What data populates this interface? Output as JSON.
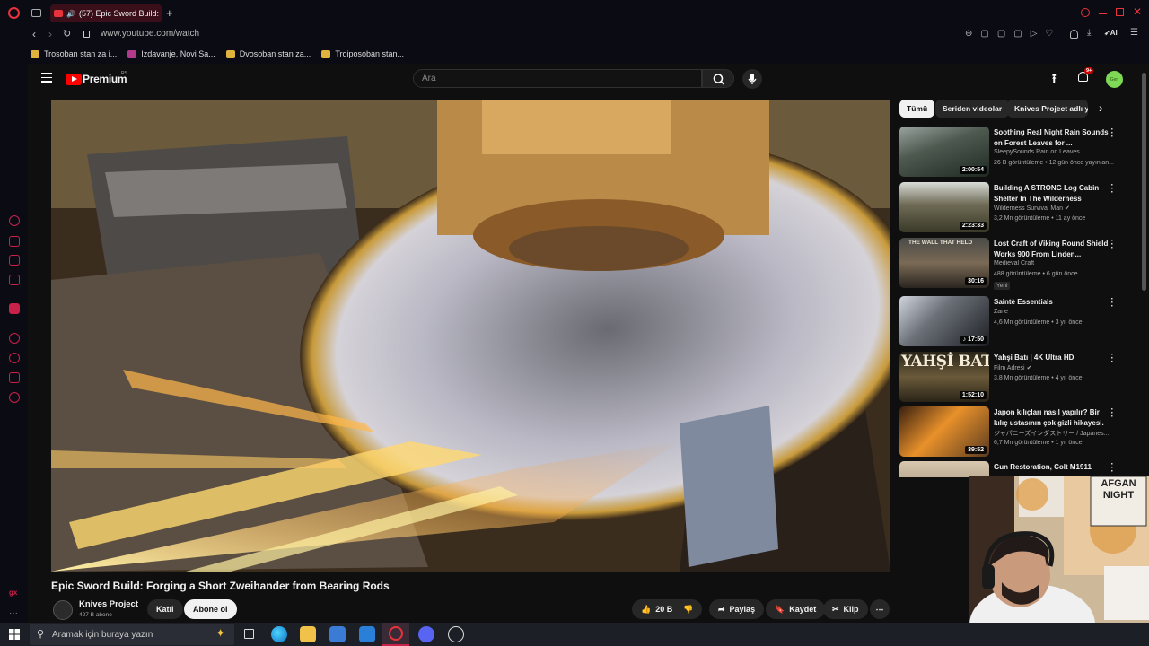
{
  "browser": {
    "tab_title": "(57) Epic Sword Build:",
    "url": "www.youtube.com/watch",
    "bookmarks": [
      "Trosoban stan za i...",
      "Izdavanje, Novi Sa...",
      "Dvosoban stan za...",
      "Troiposoban stan..."
    ],
    "ai_label": "AI",
    "side_label": "gx"
  },
  "youtube": {
    "logo_text": "Premium",
    "logo_region": "RS",
    "search_placeholder": "Ara",
    "notif_count": "9+",
    "avatar_text": "Gen",
    "video": {
      "title": "Epic Sword Build: Forging a Short Zweihander from Bearing Rods",
      "channel": "Knives Project",
      "subscribers": "427 B abone",
      "join_label": "Katıl",
      "subscribe_label": "Abone ol",
      "likes": "20 B",
      "share_label": "Paylaş",
      "save_label": "Kaydet",
      "clip_label": "Klip"
    },
    "chips": [
      "Tümü",
      "Seriden videolar",
      "Knives Project adlı yü"
    ],
    "related": [
      {
        "title": "Soothing Real Night Rain Sounds on Forest Leaves for ...",
        "channel": "SleepySounds Rain on Leaves",
        "meta": "26 B görüntüleme • 12 gün önce yayınlan...",
        "duration": "2:00:54",
        "badge": ""
      },
      {
        "title": "Building A STRONG Log Cabin Shelter In The Wilderness",
        "channel": "Wilderness Survival Man",
        "meta": "3,2 Mn görüntüleme • 11 ay önce",
        "duration": "2:23:33",
        "badge": ""
      },
      {
        "title": "Lost Craft of Viking Round Shield Works 900 From Linden...",
        "channel": "Medieval Craft",
        "meta": "488 görüntüleme • 6 gün önce",
        "duration": "30:16",
        "badge": "Yeni",
        "thumb_text": "THE WALL THAT HELD"
      },
      {
        "title": "Saintè Essentials",
        "channel": "Zane",
        "meta": "4,6 Mn görüntüleme • 3 yıl önce",
        "duration": "17:50",
        "badge": ""
      },
      {
        "title": "Yahşi Batı | 4K Ultra HD",
        "channel": "Film Adresi",
        "meta": "3,8 Mn görüntüleme • 4 yıl önce",
        "duration": "1:52:10",
        "badge": "",
        "thumb_text": "YAHŞİ BATI"
      },
      {
        "title": "Japon kılıçları nasıl yapılır? Bir kılıç ustasının çok gizli hikayesi.",
        "channel": "ジャパニーズインダストリー / Japanes...",
        "meta": "6,7 Mn görüntüleme • 1 yıl önce",
        "duration": "39:52",
        "badge": ""
      },
      {
        "title": "Gun Restoration, Colt M1911",
        "channel": "",
        "meta": "",
        "duration": "",
        "badge": ""
      }
    ]
  },
  "taskbar": {
    "search_placeholder": "Aramak için buraya yazın"
  },
  "webcam": {
    "poster_text": "AFGAN NIGHT"
  },
  "colors": {
    "yt_bg": "#0f0f0f",
    "opera_red": "#e8333a",
    "chip_active": "#f1f1f1"
  }
}
